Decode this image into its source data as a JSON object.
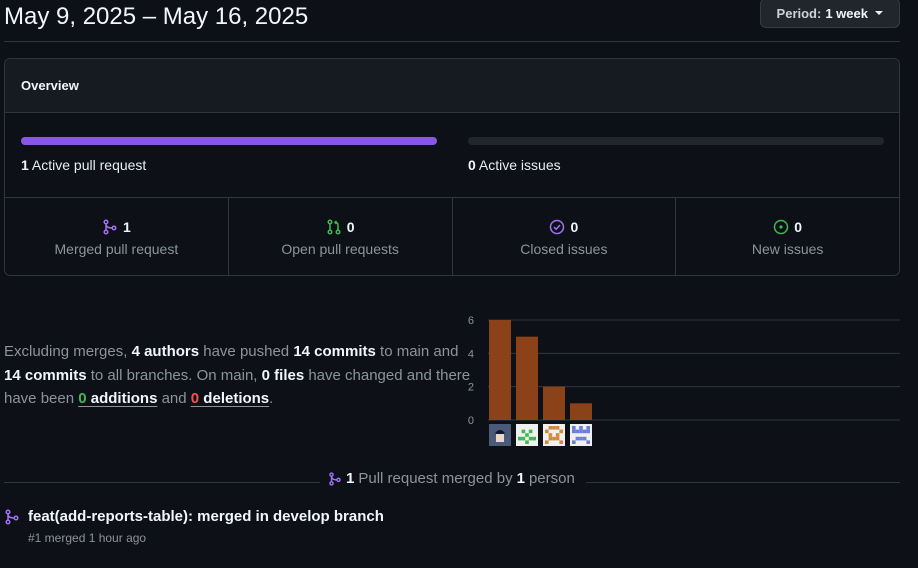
{
  "header": {
    "date_range": "May 9, 2025 – May 16, 2025",
    "period_label": "Period:",
    "period_value": "1 week"
  },
  "overview": {
    "title": "Overview",
    "active_pr": {
      "count": "1",
      "label": "Active pull request",
      "fill_fraction": 1.0,
      "color": "#8957e5"
    },
    "active_issues": {
      "count": "0",
      "label": "Active issues",
      "fill_fraction": 0.0
    },
    "stats": [
      {
        "icon": "git-merge-icon",
        "count": "1",
        "label": "Merged pull request",
        "color": "#a371f7"
      },
      {
        "icon": "git-pull-request-icon",
        "count": "0",
        "label": "Open pull requests",
        "color": "#3fb950"
      },
      {
        "icon": "issue-closed-icon",
        "count": "0",
        "label": "Closed issues",
        "color": "#a371f7"
      },
      {
        "icon": "issue-opened-icon",
        "count": "0",
        "label": "New issues",
        "color": "#3fb950"
      }
    ]
  },
  "summary": {
    "t1": "Excluding merges, ",
    "authors": "4 authors",
    "t2": " have pushed ",
    "commits_main": "14 commits",
    "t3": " to main and ",
    "commits_all": "14 commits",
    "t4": " to all branches. On main, ",
    "files": "0 files",
    "t5": " have changed and there have been ",
    "additions_n": "0",
    "additions_w": " additions",
    "t6": " and ",
    "deletions_n": "0",
    "deletions_w": " deletions",
    "t7": "."
  },
  "chart_data": {
    "type": "bar",
    "categories": [
      "author-1",
      "author-2",
      "author-3",
      "author-4"
    ],
    "values": [
      6,
      5,
      2,
      1
    ],
    "ylim": [
      0,
      6
    ],
    "yticks": [
      "0",
      "2",
      "4",
      "6"
    ],
    "bar_color": "#8b4219",
    "grid": true
  },
  "merged": {
    "count": "1",
    "t1": " Pull request merged by ",
    "people": "1",
    "t2": " person"
  },
  "pr": {
    "title": "feat(add-reports-table): merged in develop branch",
    "meta": "#1 merged 1 hour ago"
  }
}
